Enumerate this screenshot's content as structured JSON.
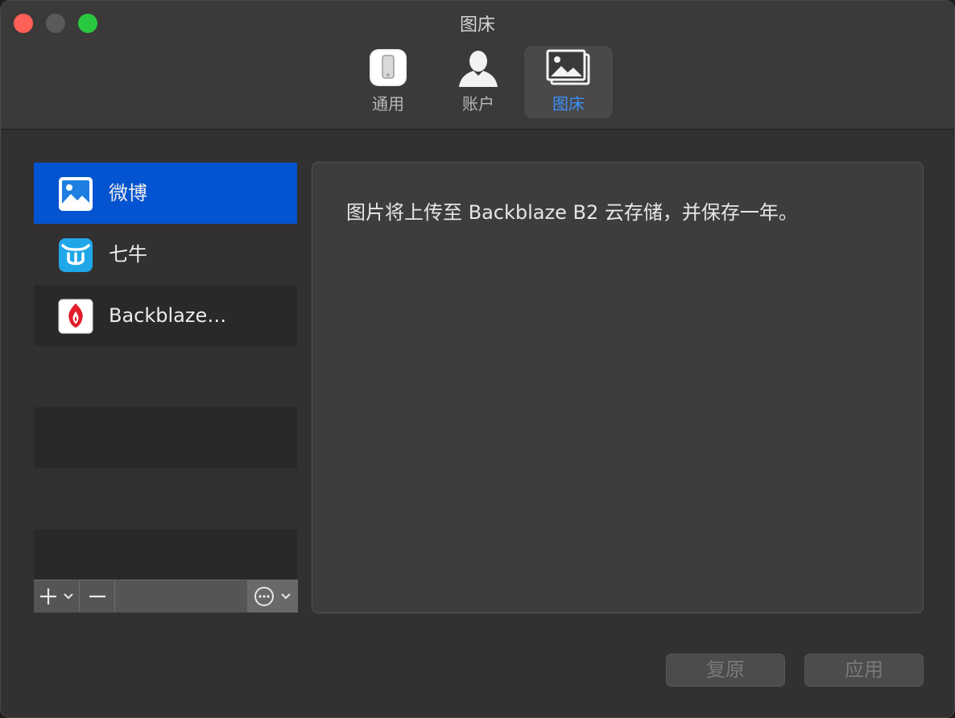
{
  "window": {
    "title": "图床"
  },
  "toolbar": {
    "items": [
      {
        "label": "通用",
        "icon": "phone-switch-icon",
        "selected": false
      },
      {
        "label": "账户",
        "icon": "user-silhouette-icon",
        "selected": false
      },
      {
        "label": "图床",
        "icon": "photos-icon",
        "selected": true
      }
    ]
  },
  "sidebar": {
    "items": [
      {
        "label": "微博",
        "icon": "image-icon",
        "selected": true
      },
      {
        "label": "七牛",
        "icon": "qiniu-logo-icon",
        "selected": false
      },
      {
        "label": "Backblaze…",
        "icon": "backblaze-flame-icon",
        "selected": false
      }
    ],
    "controls": {
      "add": "plus-icon",
      "remove": "minus-icon",
      "more": "ellipsis-circle-icon"
    }
  },
  "content": {
    "description": "图片将上传至 Backblaze B2 云存储，并保存一年。"
  },
  "buttons": {
    "restore": "复原",
    "apply": "应用"
  },
  "colors": {
    "accent": "#0453d0",
    "selected_tab_text": "#3a8ff7",
    "close": "#fe5f57",
    "maximize": "#28c840"
  }
}
